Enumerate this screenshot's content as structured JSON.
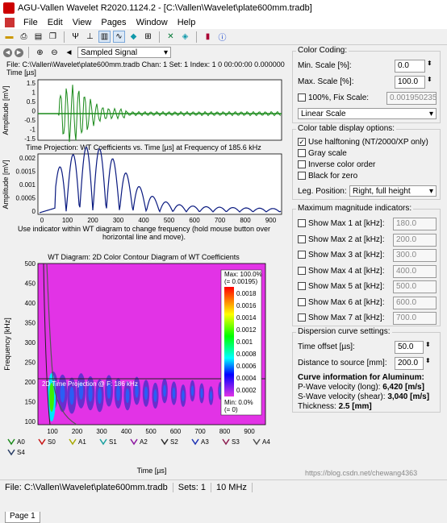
{
  "window": {
    "title": "AGU-Vallen Wavelet R2020.1124.2 - [C:\\Vallen\\Wavelet\\plate600mm.tradb]"
  },
  "menu": [
    "File",
    "Edit",
    "View",
    "Pages",
    "Window",
    "Help"
  ],
  "left": {
    "signal_select": "Sampled Signal",
    "file_info": "File: C:\\Vallen\\Wavelet\\plate600mm.tradb   Chan: 1  Set: 1  Index: 1  0 00:00:00  0.000000  Time [µs]",
    "plot1": {
      "ylabel": "Amplitude [mV]",
      "yticks": [
        "1.5",
        "1",
        "0.5",
        "0",
        "-0.5",
        "-1",
        "-1.5"
      ]
    },
    "plot2": {
      "title": "Time Projection: WT Coefficients vs. Time [µs] at Frequency of 185.6 kHz",
      "ylabel": "Amplitude [mV]",
      "yticks": [
        "0.002",
        "0.0015",
        "0.001",
        "0.0005",
        "0"
      ],
      "xticks": [
        "0",
        "100",
        "200",
        "300",
        "400",
        "500",
        "600",
        "700",
        "800",
        "900"
      ]
    },
    "hint": "Use indicator within WT diagram to change frequency (hold mouse button over horizontal line and move).",
    "plot3": {
      "title": "WT Diagram: 2D Color Contour Diagram of WT Coefficients",
      "ylabel": "Frequency [kHz]",
      "xlabel": "Time [µs]",
      "yticks": [
        "500",
        "450",
        "400",
        "350",
        "300",
        "250",
        "200",
        "150",
        "100"
      ],
      "xticks": [
        "100",
        "200",
        "300",
        "400",
        "500",
        "600",
        "700",
        "800",
        "900"
      ],
      "proj_label": "2D Time Projection @ F: 186 kHz",
      "cbar_max": "Max: 100.0%",
      "cbar_max2": "(= 0.00195)",
      "cbar_ticks": [
        "0.0018",
        "0.0016",
        "0.0014",
        "0.0012",
        "0.001",
        "0.0008",
        "0.0006",
        "0.0004",
        "0.0002"
      ],
      "cbar_min": "Min: 0.0%",
      "cbar_min2": "(= 0)"
    },
    "legend": [
      {
        "name": "A0",
        "color": "#1a8a1a"
      },
      {
        "name": "S0",
        "color": "#c81414"
      },
      {
        "name": "A1",
        "color": "#a8a800"
      },
      {
        "name": "S1",
        "color": "#1aa0a0"
      },
      {
        "name": "A2",
        "color": "#8c14a0"
      },
      {
        "name": "S2",
        "color": "#2d2d2d"
      },
      {
        "name": "A3",
        "color": "#1e32b4"
      },
      {
        "name": "S3",
        "color": "#8c1e50"
      },
      {
        "name": "A4",
        "color": "#505050"
      },
      {
        "name": "S4",
        "color": "#283c64"
      }
    ],
    "tab": "Page 1"
  },
  "right": {
    "color_coding": {
      "title": "Color Coding:",
      "min_label": "Min. Scale [%]:",
      "min_value": "0.0",
      "max_label": "Max. Scale [%]:",
      "max_value": "100.0",
      "fix_label": "100%, Fix Scale:",
      "fix_value": "0.001950235",
      "scale": "Linear Scale"
    },
    "color_table": {
      "title": "Color table display options:",
      "halftoning": "Use halftoning (NT/2000/XP only)",
      "gray": "Gray scale",
      "inverse": "Inverse color order",
      "black": "Black for zero",
      "leg_label": "Leg. Position:",
      "leg_value": "Right, full height"
    },
    "max_mag": {
      "title": "Maximum magnitude indicators:",
      "items": [
        {
          "label": "Show Max 1 at [kHz]:",
          "value": "180.0"
        },
        {
          "label": "Show Max 2 at [kHz]:",
          "value": "200.0"
        },
        {
          "label": "Show Max 3 at [kHz]:",
          "value": "300.0"
        },
        {
          "label": "Show Max 4 at [kHz]:",
          "value": "400.0"
        },
        {
          "label": "Show Max 5 at [kHz]:",
          "value": "500.0"
        },
        {
          "label": "Show Max 6 at [kHz]:",
          "value": "600.0"
        },
        {
          "label": "Show Max 7 at [kHz]:",
          "value": "700.0"
        }
      ]
    },
    "dispersion": {
      "title": "Dispersion curve settings:",
      "time_label": "Time offset [µs]:",
      "time_value": "50.0",
      "dist_label": "Distance to source [mm]:",
      "dist_value": "200.0",
      "info_title": "Curve information for Aluminum:",
      "p_wave": "P-Wave velocity (long):",
      "p_value": "6,420 [m/s]",
      "s_wave": "S-Wave velocity (shear):",
      "s_value": "3,040 [m/s]",
      "thick": "Thickness:",
      "thick_value": "2.5 [mm]"
    }
  },
  "status": {
    "file": "File: C:\\Vallen\\Wavelet\\plate600mm.tradb",
    "sets": "Sets: 1",
    "rate": "10 MHz"
  },
  "watermark": "https://blog.csdn.net/chewang4363"
}
